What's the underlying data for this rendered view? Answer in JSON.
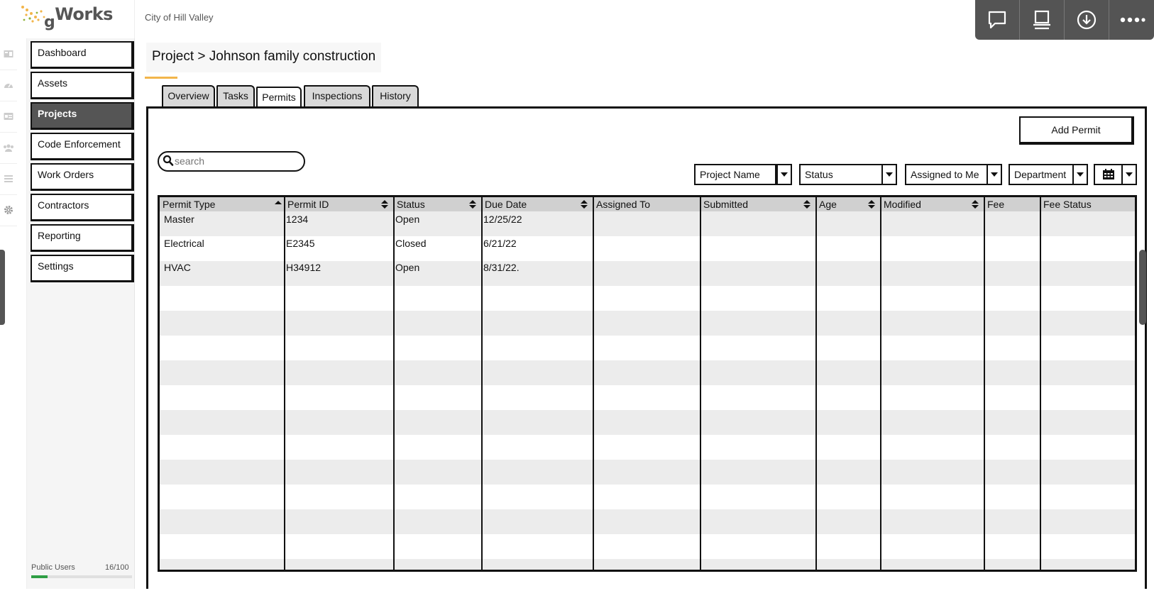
{
  "header": {
    "logo": "gWorks",
    "logo_g": "g",
    "logo_rest": "Works",
    "city": "City of Hill Valley"
  },
  "toolbar": {
    "icons": [
      "comment-icon",
      "presentation-icon",
      "download-icon",
      "more-icon"
    ]
  },
  "rail_icons": [
    "dashboard-icon",
    "gauge-icon",
    "card-icon",
    "users-icon",
    "list-icon",
    "gear-icon"
  ],
  "nav": {
    "items": [
      {
        "label": "Dashboard",
        "active": false
      },
      {
        "label": "Assets",
        "active": false
      },
      {
        "label": "Projects",
        "active": true
      },
      {
        "label": "Code Enforcement",
        "active": false
      },
      {
        "label": "Work Orders",
        "active": false
      },
      {
        "label": "Contractors",
        "active": false
      },
      {
        "label": "Reporting",
        "active": false
      },
      {
        "label": "Settings",
        "active": false
      }
    ],
    "public_users_label": "Public Users",
    "public_users_count": "16/100",
    "public_users_fraction": 0.16
  },
  "main": {
    "breadcrumb": "Project > Johnson family construction",
    "tabs": [
      {
        "label": "Overview",
        "active": false
      },
      {
        "label": "Tasks",
        "active": false
      },
      {
        "label": "Permits",
        "active": true
      },
      {
        "label": "Inspections",
        "active": false
      },
      {
        "label": "History",
        "active": false
      }
    ],
    "add_permit_label": "Add Permit",
    "search_placeholder": "search",
    "filters": [
      {
        "label": "Project Name"
      },
      {
        "label": "Status"
      },
      {
        "label": "Assigned to Me"
      },
      {
        "label": "Department"
      }
    ],
    "table": {
      "columns": [
        "Permit Type",
        "Permit ID",
        "Status",
        "Due Date",
        "Assigned To",
        "Submitted",
        "Age",
        "Modified",
        "Fee",
        "Fee Status"
      ],
      "rows": [
        [
          "Master",
          "1234",
          "Open",
          "12/25/22",
          "",
          "",
          "",
          "",
          "",
          ""
        ],
        [
          "Electrical",
          "E2345",
          "Closed",
          "6/21/22",
          "",
          "",
          "",
          "",
          "",
          ""
        ],
        [
          "HVAC",
          "H34912",
          "Open",
          "8/31/22.",
          "",
          "",
          "",
          "",
          "",
          ""
        ]
      ]
    }
  },
  "colors": {
    "active_nav": "#555555",
    "accent_underline": "#f2b54a",
    "progress": "#2e9e44",
    "toolbar_bg": "#545454"
  }
}
